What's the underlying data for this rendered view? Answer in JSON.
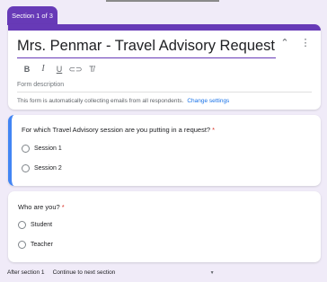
{
  "section_tab": {
    "label": "Section 1 of 3"
  },
  "header": {
    "title": "Mrs. Penmar - Travel Advisory Request",
    "description_placeholder": "Form description",
    "collect_email_note": "This form is automatically collecting emails from all respondents.",
    "change_settings_label": "Change settings",
    "collapse_icon": "collapse-icon",
    "more_icon": "more-vert-icon"
  },
  "toolbar": {
    "items": [
      {
        "name": "bold",
        "glyph": "B"
      },
      {
        "name": "italic",
        "glyph": "I"
      },
      {
        "name": "underline",
        "glyph": "U"
      },
      {
        "name": "link",
        "glyph": "⊂⊃"
      },
      {
        "name": "clear-format",
        "glyph": "T̸"
      }
    ]
  },
  "questions": [
    {
      "title": "For which Travel Advisory session are you putting in a request?",
      "required_mark": "*",
      "options": [
        "Session 1",
        "Session 2"
      ]
    },
    {
      "title": "Who are you?",
      "required_mark": "*",
      "options": [
        "Student",
        "Teacher"
      ]
    }
  ],
  "after_section": {
    "label": "After section 1",
    "selected": "Continue to next section"
  },
  "colors": {
    "accent": "#673ab7",
    "active_bar": "#4285f4",
    "link": "#1a73e8",
    "required": "#d93025",
    "background": "#f0ebf8"
  }
}
